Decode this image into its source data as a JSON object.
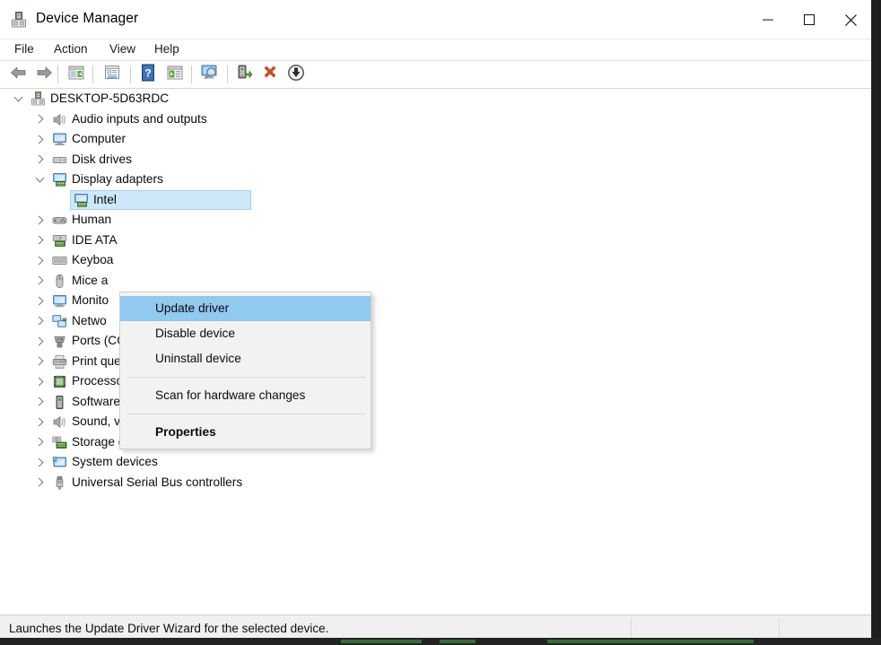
{
  "window": {
    "title": "Device Manager",
    "icon": "device-manager-icon",
    "caption_buttons": [
      {
        "name": "minimize-button",
        "glyph": "minimize-icon"
      },
      {
        "name": "maximize-button",
        "glyph": "maximize-icon"
      },
      {
        "name": "close-button",
        "glyph": "close-icon"
      }
    ]
  },
  "menubar": {
    "items": [
      {
        "label": "File"
      },
      {
        "label": "Action"
      },
      {
        "label": "View"
      },
      {
        "label": "Help"
      }
    ]
  },
  "toolbar": {
    "buttons": [
      {
        "name": "back-button",
        "icon": "back-arrow-icon"
      },
      {
        "name": "forward-button",
        "icon": "forward-arrow-icon"
      },
      {
        "name": "show-hide-console-tree-button",
        "icon": "console-tree-icon"
      },
      {
        "name": "properties-button",
        "icon": "properties-window-icon"
      },
      {
        "name": "help-button",
        "icon": "help-question-icon"
      },
      {
        "name": "update-driver-button",
        "icon": "update-driver-icon"
      },
      {
        "name": "scan-for-hardware-changes-button",
        "icon": "scan-monitor-icon"
      },
      {
        "name": "enable-device-button",
        "icon": "enable-device-icon"
      },
      {
        "name": "uninstall-device-button",
        "icon": "uninstall-x-icon"
      },
      {
        "name": "disable-device-button",
        "icon": "disable-down-arrow-icon"
      }
    ]
  },
  "tree": {
    "root": {
      "label": "DESKTOP-5D63RDC",
      "icon": "computer-root-icon",
      "expanded": true
    },
    "nodes": [
      {
        "label": "Audio inputs and outputs",
        "icon": "speaker-icon",
        "expanded": false,
        "depth": 1
      },
      {
        "label": "Computer",
        "icon": "computer-icon",
        "expanded": false,
        "depth": 1
      },
      {
        "label": "Disk drives",
        "icon": "disk-drive-icon",
        "expanded": false,
        "depth": 1
      },
      {
        "label": "Display adapters",
        "icon": "display-adapter-icon",
        "expanded": true,
        "depth": 1
      },
      {
        "label": "Intel",
        "icon": "display-adapter-icon",
        "expanded": null,
        "depth": 2,
        "selected": true
      },
      {
        "label": "Human",
        "icon": "hid-icon",
        "expanded": false,
        "depth": 1
      },
      {
        "label": "IDE ATA",
        "icon": "ide-ata-icon",
        "expanded": false,
        "depth": 1
      },
      {
        "label": "Keyboa",
        "icon": "keyboard-icon",
        "expanded": false,
        "depth": 1
      },
      {
        "label": "Mice a",
        "icon": "mouse-icon",
        "expanded": false,
        "depth": 1
      },
      {
        "label": "Monito",
        "icon": "monitor-icon",
        "expanded": false,
        "depth": 1
      },
      {
        "label": "Netwo",
        "icon": "network-adapter-icon",
        "expanded": false,
        "depth": 1
      },
      {
        "label": "Ports (COM & LPT)",
        "icon": "port-icon",
        "expanded": false,
        "depth": 1
      },
      {
        "label": "Print queues",
        "icon": "printer-icon",
        "expanded": false,
        "depth": 1
      },
      {
        "label": "Processors",
        "icon": "processor-icon",
        "expanded": false,
        "depth": 1
      },
      {
        "label": "Software devices",
        "icon": "software-device-icon",
        "expanded": false,
        "depth": 1
      },
      {
        "label": "Sound, video and game controllers",
        "icon": "speaker-icon",
        "expanded": false,
        "depth": 1
      },
      {
        "label": "Storage controllers",
        "icon": "storage-controller-icon",
        "expanded": false,
        "depth": 1
      },
      {
        "label": "System devices",
        "icon": "system-device-icon",
        "expanded": false,
        "depth": 1
      },
      {
        "label": "Universal Serial Bus controllers",
        "icon": "usb-icon",
        "expanded": false,
        "depth": 1
      }
    ]
  },
  "context_menu": {
    "items": [
      {
        "label": "Update driver",
        "highlighted": true,
        "bold": false
      },
      {
        "label": "Disable device",
        "highlighted": false,
        "bold": false
      },
      {
        "label": "Uninstall device",
        "highlighted": false,
        "bold": false
      },
      {
        "separator": true
      },
      {
        "label": "Scan for hardware changes",
        "highlighted": false,
        "bold": false
      },
      {
        "separator": true
      },
      {
        "label": "Properties",
        "highlighted": false,
        "bold": true
      }
    ]
  },
  "statusbar": {
    "text": "Launches the Update Driver Wizard for the selected device."
  },
  "colors": {
    "menu_highlight": "#91c9ef",
    "tree_selection": "#cde8f9",
    "menu_background": "#f2f2f2",
    "statusbar_background": "#f0f0f0"
  }
}
